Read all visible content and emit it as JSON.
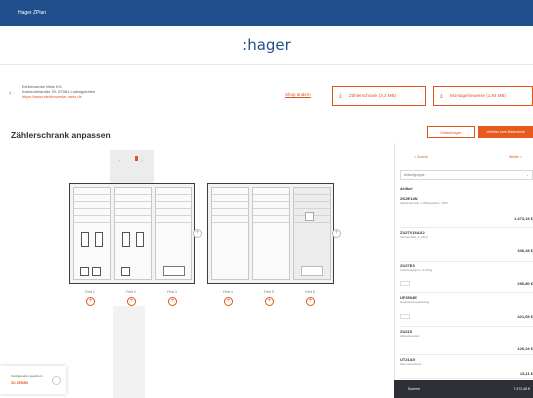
{
  "topbar": {
    "title": "Hager ZPlan"
  },
  "brand": {
    "logo": ":hager"
  },
  "customer": {
    "name": "Elektrowerke Metz KG",
    "street": "Karlsruhestraße 20, 67061 Ludwigshafen",
    "url": "https://www.elektrowerke-metz.de",
    "change_link": "Shop ändern"
  },
  "header_buttons": [
    {
      "label": "Zählerschrank (3,3 MB)",
      "icon": "download-icon"
    },
    {
      "label": "Montagehinweise (1,84 MB)",
      "icon": "download-icon"
    }
  ],
  "page": {
    "title": "Zählerschrank anpassen"
  },
  "actions": {
    "secondary": "Einstellungen",
    "primary": "Verteiler zum Warenkorb"
  },
  "cabinet": {
    "labels": [
      "Feld 1",
      "Feld 2",
      "Feld 3",
      "Feld 4",
      "Feld 5",
      "Feld 6"
    ]
  },
  "panel": {
    "prev": "< Zurück",
    "next": "Weiter >",
    "select_value": "Artikelgruppe",
    "section_title": "Artikel",
    "items": [
      {
        "code": "ZK2E14N",
        "desc": "Zählerschrank, 2 Zählerplätze, 1RfZ",
        "price": "1.473,16 €"
      },
      {
        "code": "ZU27V16AX2",
        "desc": "Verteilerfeld, 2-reihig",
        "price": "336,28 €"
      },
      {
        "code": "ZU27E3",
        "desc": "Anschlussraum, 3-reihig",
        "price": "290,80 €"
      },
      {
        "code": "UF2504E",
        "desc": "Hauptleitungsabzweig",
        "price": "421,65 €"
      },
      {
        "code": "ZU215",
        "desc": "Abdeckstreifen",
        "price": "126,24 €"
      },
      {
        "code": "UT21A9",
        "desc": "Sammelschiene",
        "price": "13,11 €"
      }
    ],
    "footer_label": "Summe",
    "footer_value": "7.472,48 €"
  },
  "config": {
    "label": "Konfiguration speichern",
    "value": "ZU 2EN5N"
  },
  "colors": {
    "accent": "#e0541c",
    "topbar": "#1f4f8c",
    "footer": "#2e3035"
  }
}
